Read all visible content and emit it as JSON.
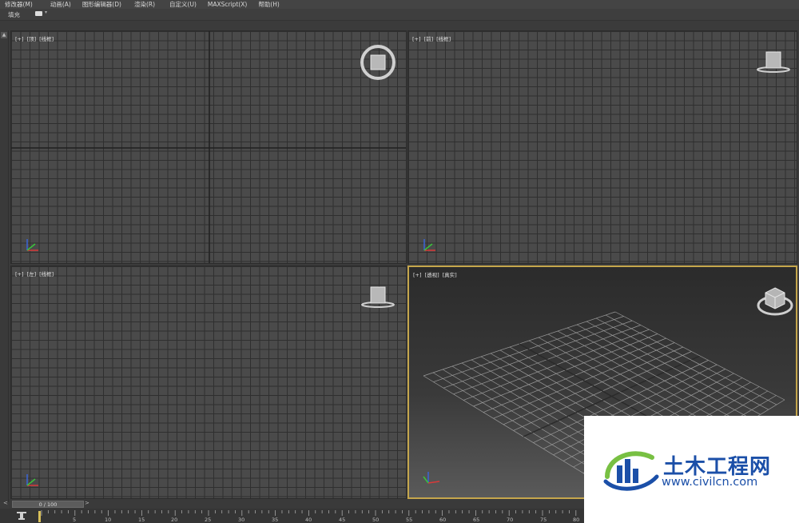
{
  "menu": [
    "修改器(M)",
    "动画(A)",
    "图形编辑器(D)",
    "渲染(R)",
    "自定义(U)",
    "MAXScript(X)",
    "帮助(H)"
  ],
  "toolbar": {
    "fill_label": "填充"
  },
  "viewports": {
    "top": {
      "plus": "[+]",
      "view": "[顶]",
      "mode": "[线框]"
    },
    "front": {
      "plus": "[+]",
      "view": "[前]",
      "mode": "[线框]"
    },
    "left": {
      "plus": "[+]",
      "view": "[左]",
      "mode": "[线框]"
    },
    "perspective": {
      "plus": "[+]",
      "view": "[透视]",
      "mode": "[真实]"
    }
  },
  "timeline": {
    "slider": "0 / 100",
    "prev": "<",
    "next": ">",
    "ticks": [
      "5",
      "10",
      "15",
      "20",
      "25",
      "30",
      "35",
      "40",
      "45",
      "50",
      "55",
      "60",
      "65",
      "70",
      "75",
      "80"
    ]
  },
  "watermark": {
    "name": "土木工程网",
    "url": "www.civilcn.com"
  }
}
